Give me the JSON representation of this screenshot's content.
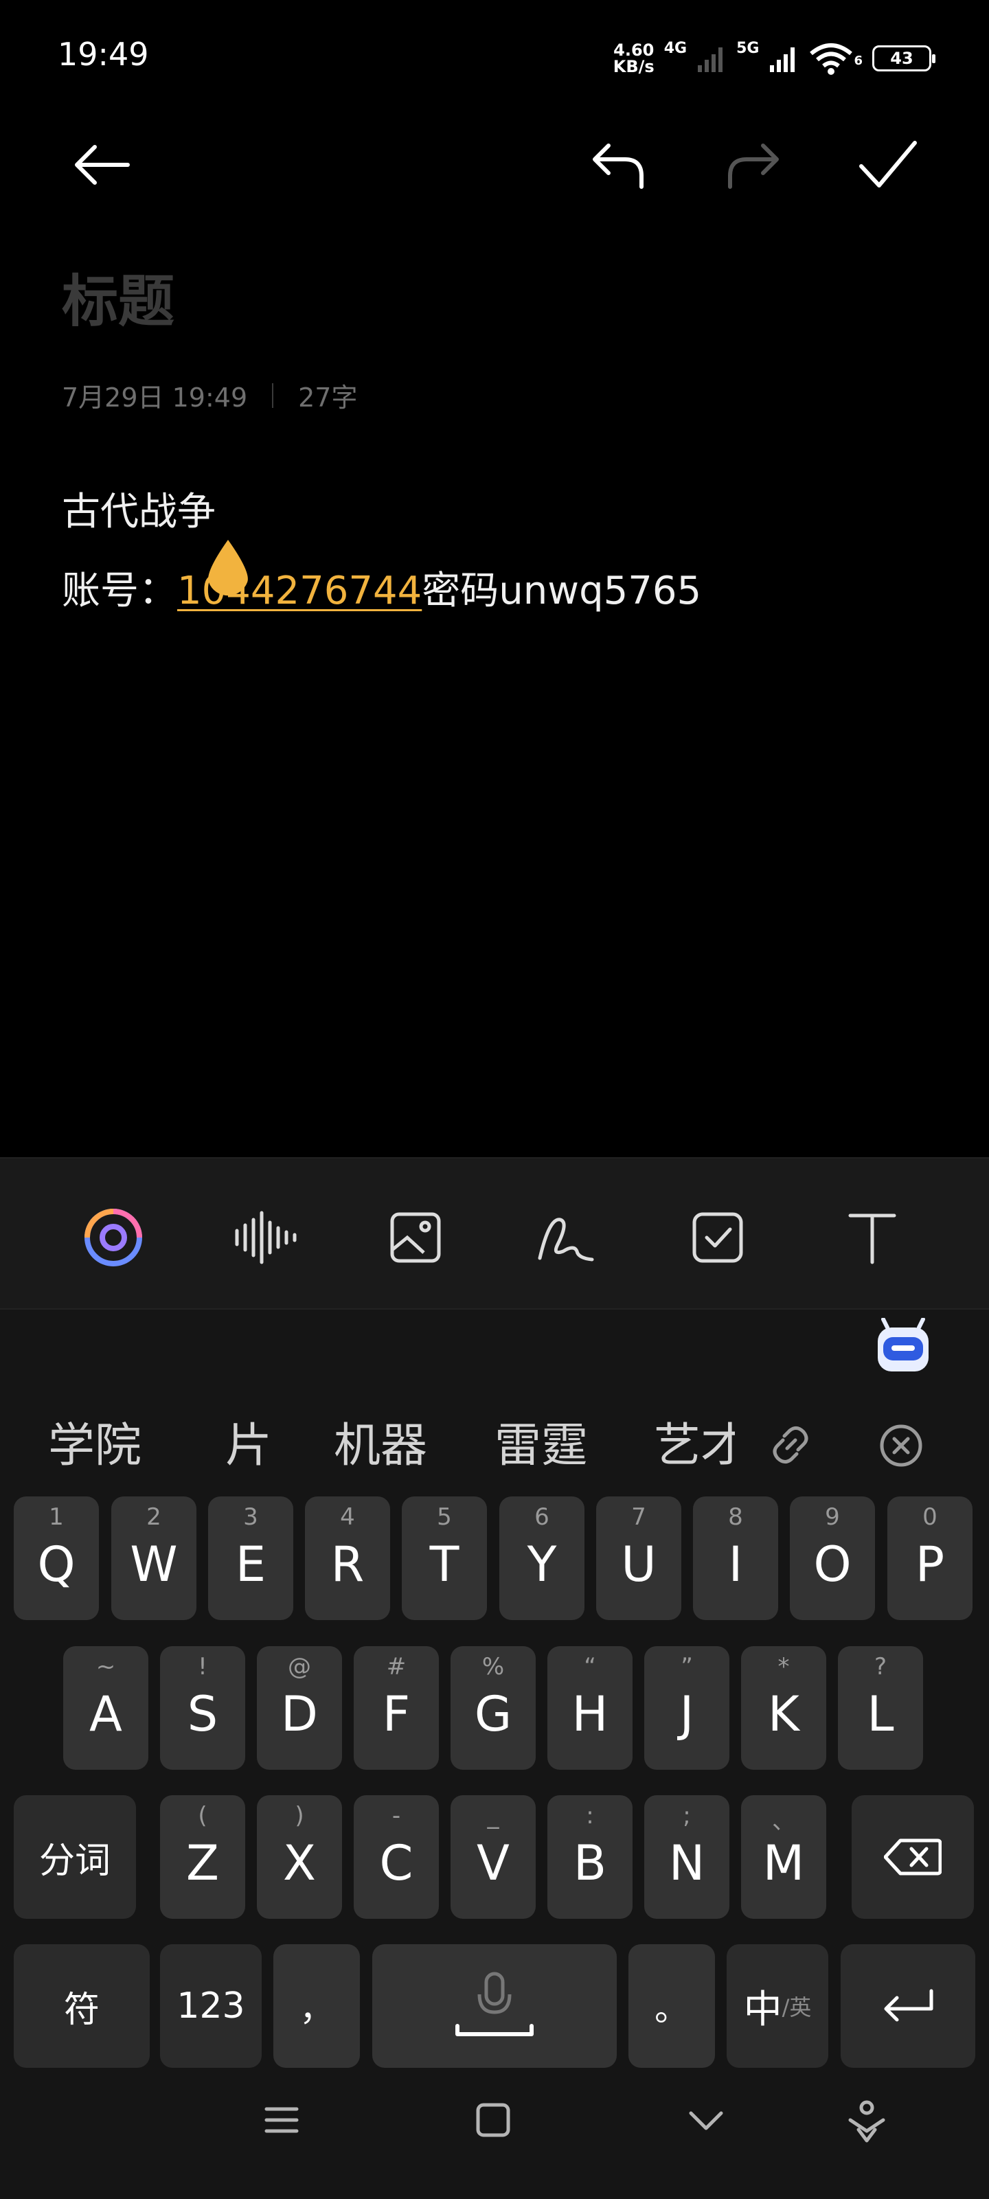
{
  "status_bar": {
    "time": "19:49",
    "net_speed_value": "4.60",
    "net_speed_unit": "KB/s",
    "network_1": "4G",
    "network_2": "5G",
    "wifi_badge": "6",
    "battery": "43"
  },
  "note": {
    "title_placeholder": "标题",
    "date": "7月29日 19:49",
    "char_count": "27字",
    "line1": "古代战争",
    "line2_prefix": "账号：",
    "line2_account": "1044276744",
    "line2_suffix": "密码unwq5765"
  },
  "editor_toolbar": {
    "icons": [
      "ai-assistant-icon",
      "voice-input-icon",
      "image-icon",
      "handwriting-icon",
      "checklist-icon",
      "text-format-icon"
    ]
  },
  "keyboard": {
    "candidates": [
      "学院",
      "片",
      "机器",
      "雷霆",
      "艺才"
    ],
    "row1": [
      {
        "key": "Q",
        "hint": "1"
      },
      {
        "key": "W",
        "hint": "2"
      },
      {
        "key": "E",
        "hint": "3"
      },
      {
        "key": "R",
        "hint": "4"
      },
      {
        "key": "T",
        "hint": "5"
      },
      {
        "key": "Y",
        "hint": "6"
      },
      {
        "key": "U",
        "hint": "7"
      },
      {
        "key": "I",
        "hint": "8"
      },
      {
        "key": "O",
        "hint": "9"
      },
      {
        "key": "P",
        "hint": "0"
      }
    ],
    "row2": [
      {
        "key": "A",
        "hint": "~"
      },
      {
        "key": "S",
        "hint": "!"
      },
      {
        "key": "D",
        "hint": "@"
      },
      {
        "key": "F",
        "hint": "#"
      },
      {
        "key": "G",
        "hint": "%"
      },
      {
        "key": "H",
        "hint": "“"
      },
      {
        "key": "J",
        "hint": "”"
      },
      {
        "key": "K",
        "hint": "*"
      },
      {
        "key": "L",
        "hint": "?"
      }
    ],
    "row3": [
      {
        "key": "Z",
        "hint": "("
      },
      {
        "key": "X",
        "hint": ")"
      },
      {
        "key": "C",
        "hint": "-"
      },
      {
        "key": "V",
        "hint": "_"
      },
      {
        "key": "B",
        "hint": ":"
      },
      {
        "key": "N",
        "hint": ";"
      },
      {
        "key": "M",
        "hint": "、"
      }
    ],
    "segment_label": "分词",
    "symbol_label": "符",
    "numbers_label": "123",
    "comma_label": "，",
    "period_label": "。",
    "lang_label_main": "中",
    "lang_label_sub": "/英"
  },
  "colors": {
    "background": "#000000",
    "accent": "#f2b33e",
    "key": "#333333",
    "keyboard_bg": "#151515"
  }
}
